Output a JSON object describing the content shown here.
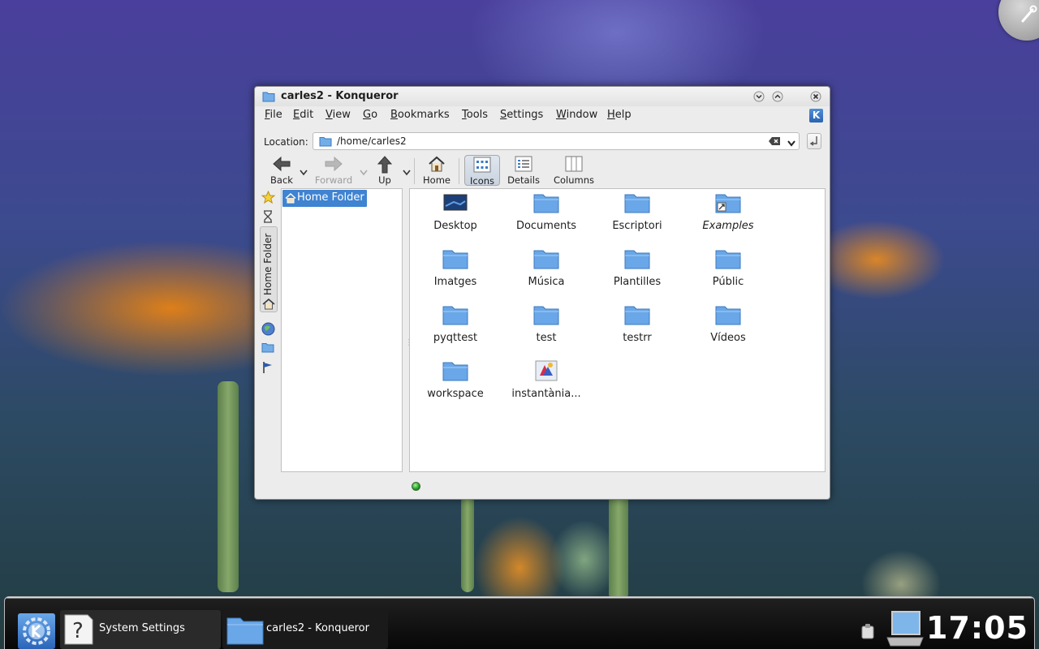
{
  "window": {
    "title": "carles2 - Konqueror",
    "menu": [
      "File",
      "Edit",
      "View",
      "Go",
      "Bookmarks",
      "Tools",
      "Settings",
      "Window",
      "Help"
    ],
    "location": {
      "label": "Location:",
      "value": "/home/carles2"
    },
    "toolbar": {
      "back": "Back",
      "forward": "Forward",
      "up": "Up",
      "home": "Home",
      "icons": "Icons",
      "details": "Details",
      "columns": "Columns"
    },
    "sidebar": {
      "tab_label": "Home Folder",
      "tree_root": "Home Folder"
    },
    "files": [
      {
        "name": "Desktop",
        "icon": "desktop-icon"
      },
      {
        "name": "Documents",
        "icon": "folder-icon"
      },
      {
        "name": "Escriptori",
        "icon": "folder-icon"
      },
      {
        "name": "Examples",
        "icon": "folder-link-icon"
      },
      {
        "name": "Imatges",
        "icon": "folder-icon"
      },
      {
        "name": "Música",
        "icon": "folder-icon"
      },
      {
        "name": "Plantilles",
        "icon": "folder-icon"
      },
      {
        "name": "Públic",
        "icon": "folder-icon"
      },
      {
        "name": "pyqttest",
        "icon": "folder-icon"
      },
      {
        "name": "test",
        "icon": "folder-icon"
      },
      {
        "name": "testrr",
        "icon": "folder-icon"
      },
      {
        "name": "Vídeos",
        "icon": "folder-icon"
      },
      {
        "name": "workspace",
        "icon": "folder-icon"
      },
      {
        "name": "instantània...",
        "icon": "image-file-icon"
      }
    ]
  },
  "taskbar": {
    "tasks": [
      {
        "label": "System Settings",
        "icon": "help-icon"
      },
      {
        "label": "carles2 - Konqueror",
        "icon": "folder-icon"
      }
    ],
    "clock": "17:05"
  },
  "colors": {
    "selection": "#3f83d1",
    "folder": "#6aa7e8",
    "taskbar": "#0a0a0a"
  }
}
